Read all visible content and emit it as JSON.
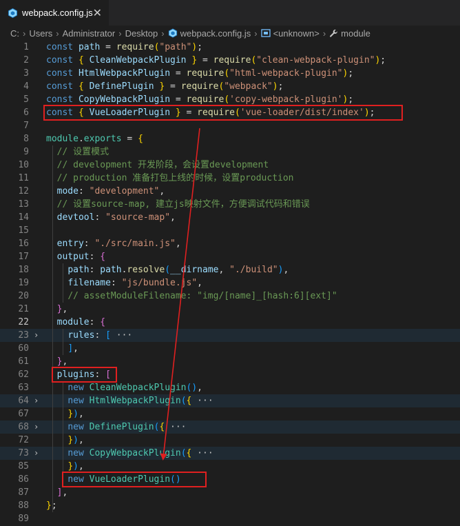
{
  "tab": {
    "filename": "webpack.config.js",
    "close": "✕"
  },
  "breadcrumb": {
    "parts": [
      "C:",
      "Users",
      "Administrator",
      "Desktop"
    ],
    "file": "webpack.config.js",
    "symbol": "<unknown>",
    "property": "module"
  },
  "lines": [
    {
      "n": "1",
      "tokens": [
        [
          "k",
          "const "
        ],
        [
          "v",
          "path"
        ],
        [
          "p",
          " = "
        ],
        [
          "f",
          "require"
        ],
        [
          "b1",
          "("
        ],
        [
          "s",
          "\"path\""
        ],
        [
          "b1",
          ")"
        ],
        [
          "p",
          ";"
        ]
      ]
    },
    {
      "n": "2",
      "tokens": [
        [
          "k",
          "const "
        ],
        [
          "b1",
          "{ "
        ],
        [
          "v",
          "CleanWebpackPlugin"
        ],
        [
          "b1",
          " }"
        ],
        [
          "p",
          " = "
        ],
        [
          "f",
          "require"
        ],
        [
          "b1",
          "("
        ],
        [
          "s",
          "\"clean-webpack-plugin\""
        ],
        [
          "b1",
          ")"
        ],
        [
          "p",
          ";"
        ]
      ]
    },
    {
      "n": "3",
      "tokens": [
        [
          "k",
          "const "
        ],
        [
          "v",
          "HtmlWebpackPlugin"
        ],
        [
          "p",
          " = "
        ],
        [
          "f",
          "require"
        ],
        [
          "b1",
          "("
        ],
        [
          "s",
          "\"html-webpack-plugin\""
        ],
        [
          "b1",
          ")"
        ],
        [
          "p",
          ";"
        ]
      ]
    },
    {
      "n": "4",
      "tokens": [
        [
          "k",
          "const "
        ],
        [
          "b1",
          "{ "
        ],
        [
          "v",
          "DefinePlugin"
        ],
        [
          "b1",
          " }"
        ],
        [
          "p",
          " = "
        ],
        [
          "f",
          "require"
        ],
        [
          "b1",
          "("
        ],
        [
          "s",
          "\"webpack\""
        ],
        [
          "b1",
          ")"
        ],
        [
          "p",
          ";"
        ]
      ]
    },
    {
      "n": "5",
      "tokens": [
        [
          "k",
          "const "
        ],
        [
          "v",
          "CopyWebpackPlugin"
        ],
        [
          "p",
          " = "
        ],
        [
          "f",
          "require"
        ],
        [
          "b1",
          "("
        ],
        [
          "s",
          "'copy-webpack-plugin'"
        ],
        [
          "b1",
          ")"
        ],
        [
          "p",
          ";"
        ]
      ]
    },
    {
      "n": "6",
      "tokens": [
        [
          "k",
          "const "
        ],
        [
          "b1",
          "{ "
        ],
        [
          "v",
          "VueLoaderPlugin"
        ],
        [
          "b1",
          " }"
        ],
        [
          "p",
          " = "
        ],
        [
          "f",
          "require"
        ],
        [
          "b1",
          "("
        ],
        [
          "s",
          "'vue-loader/dist/index'"
        ],
        [
          "b1",
          ")"
        ],
        [
          "p",
          ";"
        ]
      ]
    },
    {
      "n": "7",
      "tokens": []
    },
    {
      "n": "8",
      "tokens": [
        [
          "c",
          "module"
        ],
        [
          "p",
          "."
        ],
        [
          "c",
          "exports"
        ],
        [
          "p",
          " = "
        ],
        [
          "b1",
          "{"
        ]
      ]
    },
    {
      "n": "9",
      "tokens": [
        [
          "p",
          "  "
        ],
        [
          "cm",
          "// 设置模式"
        ]
      ]
    },
    {
      "n": "10",
      "tokens": [
        [
          "p",
          "  "
        ],
        [
          "cm",
          "// development 开发阶段，会设置development"
        ]
      ]
    },
    {
      "n": "11",
      "tokens": [
        [
          "p",
          "  "
        ],
        [
          "cm",
          "// production 准备打包上线的时候，设置production"
        ]
      ]
    },
    {
      "n": "12",
      "tokens": [
        [
          "p",
          "  "
        ],
        [
          "v",
          "mode"
        ],
        [
          "p",
          ": "
        ],
        [
          "s",
          "\"development\""
        ],
        [
          "p",
          ","
        ]
      ]
    },
    {
      "n": "13",
      "tokens": [
        [
          "p",
          "  "
        ],
        [
          "cm",
          "// 设置source-map, 建立js映射文件，方便调试代码和错误"
        ]
      ]
    },
    {
      "n": "14",
      "tokens": [
        [
          "p",
          "  "
        ],
        [
          "v",
          "devtool"
        ],
        [
          "p",
          ": "
        ],
        [
          "s",
          "\"source-map\""
        ],
        [
          "p",
          ","
        ]
      ]
    },
    {
      "n": "15",
      "tokens": []
    },
    {
      "n": "16",
      "tokens": [
        [
          "p",
          "  "
        ],
        [
          "v",
          "entry"
        ],
        [
          "p",
          ": "
        ],
        [
          "s",
          "\"./src/main.js\""
        ],
        [
          "p",
          ","
        ]
      ]
    },
    {
      "n": "17",
      "tokens": [
        [
          "p",
          "  "
        ],
        [
          "v",
          "output"
        ],
        [
          "p",
          ": "
        ],
        [
          "b2",
          "{"
        ]
      ]
    },
    {
      "n": "18",
      "tokens": [
        [
          "p",
          "    "
        ],
        [
          "v",
          "path"
        ],
        [
          "p",
          ": "
        ],
        [
          "v",
          "path"
        ],
        [
          "p",
          "."
        ],
        [
          "f",
          "resolve"
        ],
        [
          "b3",
          "("
        ],
        [
          "v",
          "__dirname"
        ],
        [
          "p",
          ", "
        ],
        [
          "s",
          "\"./build\""
        ],
        [
          "b3",
          ")"
        ],
        [
          "p",
          ","
        ]
      ]
    },
    {
      "n": "19",
      "tokens": [
        [
          "p",
          "    "
        ],
        [
          "v",
          "filename"
        ],
        [
          "p",
          ": "
        ],
        [
          "s",
          "\"js/bundle.js\""
        ],
        [
          "p",
          ","
        ]
      ]
    },
    {
      "n": "20",
      "tokens": [
        [
          "p",
          "    "
        ],
        [
          "cm",
          "// assetModuleFilename: \"img/[name]_[hash:6][ext]\""
        ]
      ]
    },
    {
      "n": "21",
      "tokens": [
        [
          "p",
          "  "
        ],
        [
          "b2",
          "}"
        ],
        [
          "p",
          ","
        ]
      ]
    },
    {
      "n": "22",
      "active": true,
      "tokens": [
        [
          "p",
          "  "
        ],
        [
          "v",
          "module"
        ],
        [
          "p",
          ": "
        ],
        [
          "b2",
          "{"
        ]
      ]
    },
    {
      "n": "23",
      "fold": true,
      "tokens": [
        [
          "p",
          "    "
        ],
        [
          "v",
          "rules"
        ],
        [
          "p",
          ": "
        ],
        [
          "b3",
          "["
        ],
        [
          "ell",
          " ···"
        ]
      ]
    },
    {
      "n": "60",
      "tokens": [
        [
          "p",
          "    "
        ],
        [
          "b3",
          "]"
        ],
        [
          "p",
          ","
        ]
      ]
    },
    {
      "n": "61",
      "tokens": [
        [
          "p",
          "  "
        ],
        [
          "b2",
          "}"
        ],
        [
          "p",
          ","
        ]
      ]
    },
    {
      "n": "62",
      "tokens": [
        [
          "p",
          "  "
        ],
        [
          "v",
          "plugins"
        ],
        [
          "p",
          ": "
        ],
        [
          "b2",
          "["
        ]
      ]
    },
    {
      "n": "63",
      "tokens": [
        [
          "p",
          "    "
        ],
        [
          "k",
          "new "
        ],
        [
          "c",
          "CleanWebpackPlugin"
        ],
        [
          "b3",
          "()"
        ],
        [
          "p",
          ","
        ]
      ]
    },
    {
      "n": "64",
      "fold": true,
      "tokens": [
        [
          "p",
          "    "
        ],
        [
          "k",
          "new "
        ],
        [
          "c",
          "HtmlWebpackPlugin"
        ],
        [
          "b3",
          "("
        ],
        [
          "b1",
          "{"
        ],
        [
          "ell",
          " ···"
        ]
      ]
    },
    {
      "n": "67",
      "tokens": [
        [
          "p",
          "    "
        ],
        [
          "b1",
          "}"
        ],
        [
          "b3",
          ")"
        ],
        [
          "p",
          ","
        ]
      ]
    },
    {
      "n": "68",
      "fold": true,
      "tokens": [
        [
          "p",
          "    "
        ],
        [
          "k",
          "new "
        ],
        [
          "c",
          "DefinePlugin"
        ],
        [
          "b3",
          "("
        ],
        [
          "b1",
          "{"
        ],
        [
          "ell",
          " ···"
        ]
      ]
    },
    {
      "n": "72",
      "tokens": [
        [
          "p",
          "    "
        ],
        [
          "b1",
          "}"
        ],
        [
          "b3",
          ")"
        ],
        [
          "p",
          ","
        ]
      ]
    },
    {
      "n": "73",
      "fold": true,
      "tokens": [
        [
          "p",
          "    "
        ],
        [
          "k",
          "new "
        ],
        [
          "c",
          "CopyWebpackPlugin"
        ],
        [
          "b3",
          "("
        ],
        [
          "b1",
          "{"
        ],
        [
          "ell",
          " ···"
        ]
      ]
    },
    {
      "n": "85",
      "tokens": [
        [
          "p",
          "    "
        ],
        [
          "b1",
          "}"
        ],
        [
          "b3",
          ")"
        ],
        [
          "p",
          ","
        ]
      ]
    },
    {
      "n": "86",
      "tokens": [
        [
          "p",
          "    "
        ],
        [
          "k",
          "new "
        ],
        [
          "c",
          "VueLoaderPlugin"
        ],
        [
          "b3",
          "()"
        ]
      ]
    },
    {
      "n": "87",
      "tokens": [
        [
          "p",
          "  "
        ],
        [
          "b2",
          "]"
        ],
        [
          "p",
          ","
        ]
      ]
    },
    {
      "n": "88",
      "tokens": [
        [
          "b1",
          "}"
        ],
        [
          "p",
          ";"
        ]
      ]
    },
    {
      "n": "89",
      "tokens": []
    }
  ],
  "colors": {
    "highlight_box": "#e02020",
    "arrow": "#e02020"
  }
}
